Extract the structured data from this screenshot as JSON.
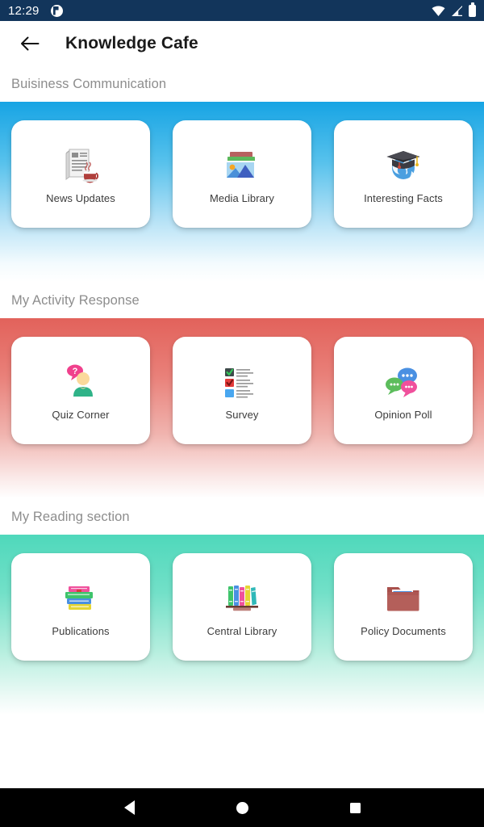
{
  "statusbar": {
    "time": "12:29",
    "notification_icon": "notification-circle-icon",
    "wifi_icon": "wifi-icon",
    "signal_icon": "cell-signal-icon",
    "battery_icon": "battery-full-icon",
    "bg_color": "#12355B"
  },
  "appbar": {
    "back_icon": "back-arrow-icon",
    "title": "Knowledge Cafe"
  },
  "navbar": {
    "back_label": "back-triangle-icon",
    "home_label": "home-circle-icon",
    "recents_label": "recents-square-icon"
  },
  "sections": [
    {
      "title": "Buisiness Communication",
      "accent": "#17a4e4",
      "cards": [
        {
          "label": "News Updates",
          "icon": "newspaper-coffee-icon"
        },
        {
          "label": "Media Library",
          "icon": "photo-stack-icon"
        },
        {
          "label": "Interesting Facts",
          "icon": "globe-graduation-cap-icon"
        }
      ]
    },
    {
      "title": "My Activity Response",
      "accent": "#e2625b",
      "cards": [
        {
          "label": "Quiz Corner",
          "icon": "person-question-bubble-icon"
        },
        {
          "label": "Survey",
          "icon": "checklist-icon"
        },
        {
          "label": "Opinion Poll",
          "icon": "speech-bubbles-icon"
        }
      ]
    },
    {
      "title": "My Reading section",
      "accent": "#4fd8bb",
      "cards": [
        {
          "label": "Publications",
          "icon": "book-stack-icon"
        },
        {
          "label": "Central Library",
          "icon": "bookshelf-icon"
        },
        {
          "label": "Policy Documents",
          "icon": "folder-documents-icon"
        }
      ]
    }
  ]
}
